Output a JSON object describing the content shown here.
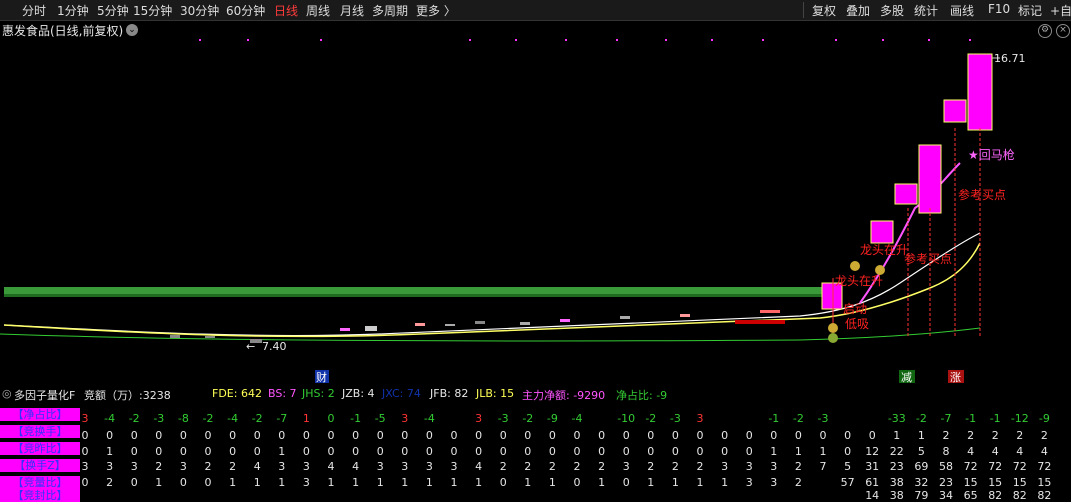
{
  "toolbar": {
    "timeframes": [
      "分时",
      "1分钟",
      "5分钟",
      "15分钟",
      "30分钟",
      "60分钟",
      "日线",
      "周线",
      "月线",
      "多周期",
      "更多 〉"
    ],
    "active": "日线",
    "right_items": [
      "复权",
      "叠加",
      "多股",
      "统计",
      "画线",
      "F10",
      "标记",
      "+自"
    ]
  },
  "stock": {
    "title": "惠发食品(日线,前复权)"
  },
  "price": {
    "high_label": "16.71",
    "low_label": "7.40"
  },
  "chart_markers": {
    "cai": "财",
    "jian": "减",
    "zhang": "涨"
  },
  "annotations": [
    "回马枪",
    "参考买点",
    "龙头在升",
    "参考买点",
    "龙头在升",
    "启动",
    "低吸"
  ],
  "indicator": {
    "name": "多因子量化F",
    "jinge": "竞额（万）:3238",
    "fde": "FDE: 642",
    "bs": "BS: 7",
    "jhs": "JHS: 2",
    "jzb": "JZB: 4",
    "hidden": "JXC: 74",
    "jfb": "JFB: 82",
    "jlb": "JLB: 15",
    "zljd": "主力净额: -9290",
    "jzb2": "净占比: -9"
  },
  "row_labels": [
    "【净占比】",
    "【竞换手】",
    "【竞昨比】",
    "【换手Z】",
    "【竞量比】",
    "【竞封比】"
  ],
  "table": {
    "row0": [
      "3",
      "-4",
      "-2",
      "-3",
      "-8",
      "-2",
      "-4",
      "-2",
      "-7",
      "1",
      "0",
      "-1",
      "-5",
      "3",
      "-4",
      "",
      "3",
      "-3",
      "-2",
      "-9",
      "-4",
      "",
      "-10",
      "-2",
      "-3",
      "3",
      "",
      "",
      "-1",
      "-2",
      "-3",
      "",
      "",
      "-33",
      "-2",
      "-7",
      "-1",
      "-1",
      "-12",
      "-9"
    ],
    "row1": [
      "0",
      "0",
      "0",
      "0",
      "0",
      "0",
      "0",
      "0",
      "0",
      "0",
      "0",
      "0",
      "0",
      "0",
      "0",
      "0",
      "0",
      "0",
      "0",
      "0",
      "0",
      "0",
      "0",
      "0",
      "0",
      "0",
      "0",
      "0",
      "0",
      "0",
      "0",
      "0",
      "0",
      "1",
      "1",
      "2",
      "2",
      "2",
      "2",
      "2"
    ],
    "row2": [
      "0",
      "1",
      "0",
      "0",
      "0",
      "0",
      "0",
      "0",
      "1",
      "0",
      "0",
      "0",
      "0",
      "0",
      "0",
      "0",
      "0",
      "0",
      "0",
      "0",
      "0",
      "0",
      "0",
      "0",
      "0",
      "0",
      "0",
      "0",
      "1",
      "1",
      "1",
      "0",
      "12",
      "22",
      "5",
      "8",
      "4",
      "4",
      "4",
      "4"
    ],
    "row3": [
      "3",
      "3",
      "3",
      "2",
      "3",
      "2",
      "2",
      "4",
      "3",
      "3",
      "4",
      "4",
      "3",
      "3",
      "3",
      "3",
      "4",
      "2",
      "2",
      "2",
      "2",
      "2",
      "3",
      "2",
      "2",
      "2",
      "3",
      "3",
      "3",
      "2",
      "7",
      "5",
      "31",
      "23",
      "69",
      "58",
      "72",
      "72",
      "72",
      "72"
    ],
    "row4": [
      "0",
      "2",
      "0",
      "1",
      "0",
      "0",
      "1",
      "1",
      "1",
      "3",
      "1",
      "1",
      "1",
      "1",
      "1",
      "1",
      "1",
      "0",
      "1",
      "1",
      "0",
      "1",
      "0",
      "1",
      "1",
      "1",
      "1",
      "3",
      "3",
      "2",
      "",
      "57",
      "61",
      "38",
      "32",
      "23",
      "15",
      "15",
      "15",
      "15"
    ],
    "row5": [
      "",
      "",
      "",
      "",
      "",
      "",
      "",
      "",
      "",
      "",
      "",
      "",
      "",
      "",
      "",
      "",
      "",
      "",
      "",
      "",
      "",
      "",
      "",
      "",
      "",
      "",
      "",
      "",
      "",
      "",
      "",
      "",
      "14",
      "38",
      "79",
      "34",
      "65",
      "82",
      "82",
      "82"
    ]
  }
}
